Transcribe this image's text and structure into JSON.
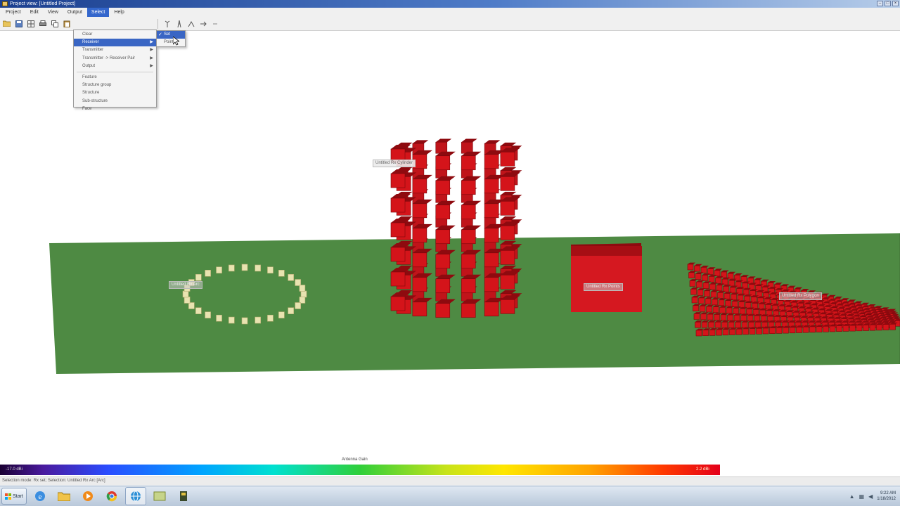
{
  "window": {
    "title": "Project view: [Untitled Project]"
  },
  "menubar": {
    "items": [
      "Project",
      "Edit",
      "View",
      "Output",
      "Select",
      "Help"
    ],
    "active_index": 4
  },
  "toolbar": {
    "icons": [
      "folder-open-icon",
      "save-icon",
      "grid-icon",
      "print-icon",
      "copy-icon",
      "paste-icon"
    ],
    "right_icons": [
      "antenna-icon",
      "tower-icon",
      "route-icon",
      "link-icon",
      "more-icon"
    ]
  },
  "dropdown": {
    "items": [
      {
        "label": "Clear",
        "submenu": false
      },
      {
        "label": "Receiver",
        "submenu": true,
        "active": true
      },
      {
        "label": "Transmitter",
        "submenu": true
      },
      {
        "label": "Transmitter -> Receiver Pair",
        "submenu": true
      },
      {
        "label": "Output",
        "submenu": true
      },
      {
        "label": "Feature",
        "submenu": false
      },
      {
        "label": "Structure group",
        "submenu": false
      },
      {
        "label": "Structure",
        "submenu": false
      },
      {
        "label": "Sub-structure",
        "submenu": false
      },
      {
        "label": "Face",
        "submenu": false
      }
    ]
  },
  "submenu": {
    "items": [
      {
        "label": "Set",
        "checked": true,
        "active": true
      },
      {
        "label": "Point",
        "checked": false
      }
    ]
  },
  "scene": {
    "labels": {
      "cylinder": "Untitled Rx Cylinder",
      "ring": "Untitled Rx Arc",
      "box": "Untitled Rx Points",
      "wedge": "Untitled Rx Polygon"
    },
    "colors": {
      "ground": "#4e8a43",
      "receiver_red": "#d4141a",
      "ring_marker": "#e8e3b0"
    }
  },
  "colorbar": {
    "title": "Antenna Gain",
    "min_label": "-17.0 dBi",
    "max_label": "2.2 dBi"
  },
  "statusbar": {
    "text": "Selection mode: Rx set;  Selection: Untitled Rx Arc [Arc]"
  },
  "taskbar": {
    "start_label": "Start",
    "apps": [
      "ie-icon",
      "folder-icon",
      "media-player-icon",
      "chrome-icon",
      "network-globe-icon",
      "explorer-icon",
      "wireless-insite-icon"
    ],
    "active_app_index": 4,
    "clock_time": "9:22 AM",
    "clock_date": "1/18/2012"
  }
}
